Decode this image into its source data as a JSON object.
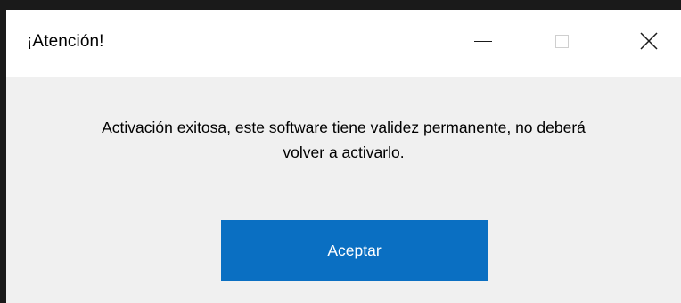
{
  "window": {
    "title": "¡Atención!",
    "controls": {
      "minimize_icon": "minimize-icon",
      "maximize_icon": "maximize-icon",
      "close_icon": "close-icon"
    }
  },
  "dialog": {
    "message_line1": "Activación exitosa, este software tiene validez permanente, no deberá",
    "message_line2": "volver a activarlo.",
    "ok_label": "Aceptar"
  },
  "colors": {
    "accent": "#0a6fc2",
    "titlebar": "#ffffff",
    "body": "#f0f0f0"
  }
}
